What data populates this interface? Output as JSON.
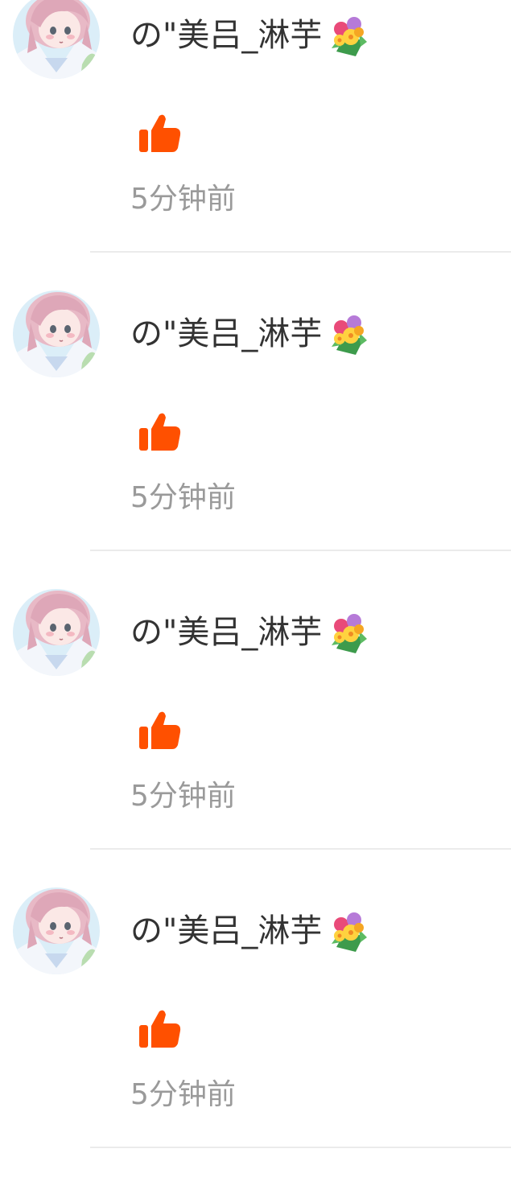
{
  "colors": {
    "like": "#ff5000",
    "name_text": "#333333",
    "time_text": "#9a9a9a",
    "divider": "#ebebeb"
  },
  "items": [
    {
      "user_name": "の\"美吕_淋芋",
      "name_emoji": "flower-bouquet-icon",
      "action_icon": "thumbs-up-icon",
      "time": "5分钟前"
    },
    {
      "user_name": "の\"美吕_淋芋",
      "name_emoji": "flower-bouquet-icon",
      "action_icon": "thumbs-up-icon",
      "time": "5分钟前"
    },
    {
      "user_name": "の\"美吕_淋芋",
      "name_emoji": "flower-bouquet-icon",
      "action_icon": "thumbs-up-icon",
      "time": "5分钟前"
    },
    {
      "user_name": "の\"美吕_淋芋",
      "name_emoji": "flower-bouquet-icon",
      "action_icon": "thumbs-up-icon",
      "time": "5分钟前"
    }
  ]
}
